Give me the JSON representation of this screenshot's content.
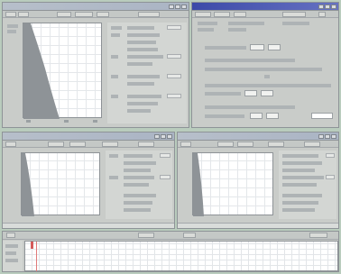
{
  "app": {
    "description_free": true
  },
  "windows": {
    "top_left": {
      "title": ""
    },
    "top_right": {
      "title": ""
    },
    "bottom_left": {
      "title": ""
    },
    "bottom_right": {
      "title": ""
    },
    "bottom_sheet": {
      "title": ""
    }
  },
  "colors": {
    "desktop": "#b9ccbd",
    "active_titlebar": "#3c4aa8",
    "inactive_titlebar": "#aab4c4",
    "plot_fill": "#8e9397",
    "marker": "#d45a5a"
  },
  "icons": {
    "close": "close-icon",
    "minimize": "minimize-icon",
    "maximize": "maximize-icon"
  }
}
